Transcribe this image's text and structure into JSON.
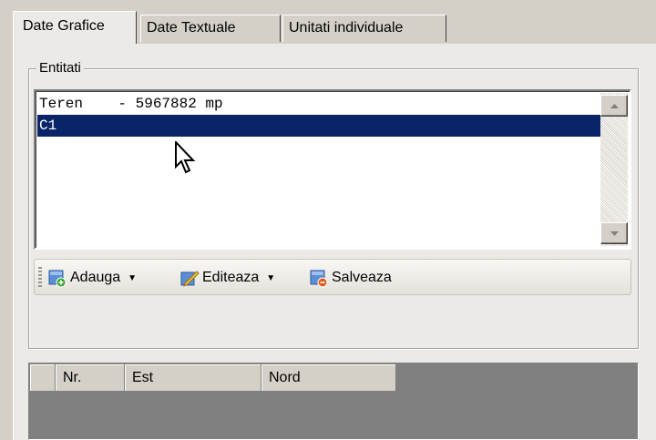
{
  "tabs": [
    {
      "label": "Date Grafice",
      "active": true
    },
    {
      "label": "Date Textuale",
      "active": false
    },
    {
      "label": "Unitati individuale",
      "active": false
    }
  ],
  "entities": {
    "legend": "Entitati",
    "items": [
      {
        "text": "Teren    - 5967882 mp",
        "selected": false
      },
      {
        "text": "C1",
        "selected": true
      }
    ]
  },
  "toolbar": {
    "add_label": "Adauga",
    "edit_label": "Editeaza",
    "save_label": "Salveaza"
  },
  "grid": {
    "columns": [
      "Nr.",
      "Est",
      "Nord"
    ]
  },
  "colors": {
    "selection": "#0a246a",
    "window": "#d4d0c8",
    "grid_background": "#808080"
  }
}
